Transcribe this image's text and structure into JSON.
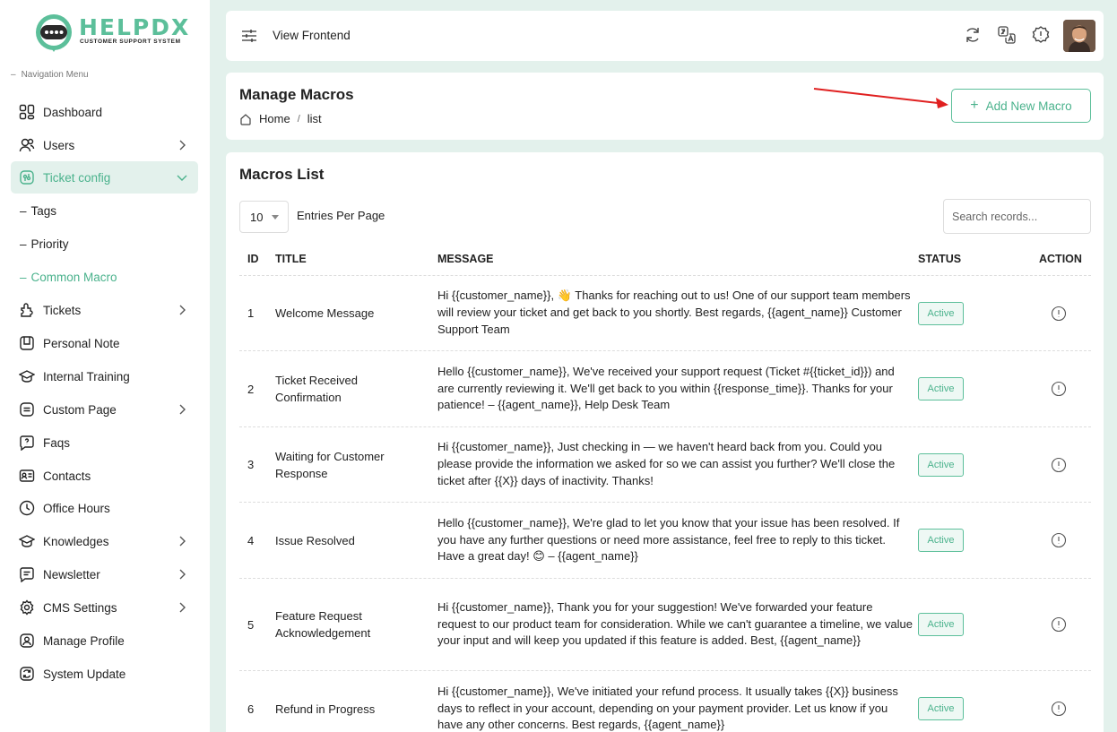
{
  "brand": {
    "name": "HELPDX",
    "tagline": "CUSTOMER SUPPORT SYSTEM",
    "color": "#5cbf9a"
  },
  "sidebar": {
    "section_title": "Navigation Menu",
    "items": [
      {
        "label": "Dashboard",
        "icon": "dashboard-icon"
      },
      {
        "label": "Users",
        "icon": "users-icon",
        "expandable": true
      },
      {
        "label": "Ticket config",
        "icon": "ticket-config-icon",
        "expandable": true,
        "expanded": true,
        "active": true
      },
      {
        "label": "Tags",
        "sub": true
      },
      {
        "label": "Priority",
        "sub": true
      },
      {
        "label": "Common Macro",
        "sub": true,
        "active": true
      },
      {
        "label": "Tickets",
        "icon": "tickets-icon",
        "expandable": true
      },
      {
        "label": "Personal Note",
        "icon": "note-icon"
      },
      {
        "label": "Internal Training",
        "icon": "training-icon"
      },
      {
        "label": "Custom Page",
        "icon": "custom-page-icon",
        "expandable": true
      },
      {
        "label": "Faqs",
        "icon": "faq-icon"
      },
      {
        "label": "Contacts",
        "icon": "contacts-icon"
      },
      {
        "label": "Office Hours",
        "icon": "clock-icon"
      },
      {
        "label": "Knowledges",
        "icon": "knowledge-icon",
        "expandable": true
      },
      {
        "label": "Newsletter",
        "icon": "newsletter-icon",
        "expandable": true
      },
      {
        "label": "CMS Settings",
        "icon": "settings-icon",
        "expandable": true
      },
      {
        "label": "Manage Profile",
        "icon": "profile-icon"
      },
      {
        "label": "System Update",
        "icon": "update-icon"
      }
    ]
  },
  "topbar": {
    "view_frontend": "View Frontend",
    "icons": [
      "refresh-icon",
      "translate-icon",
      "alert-icon"
    ]
  },
  "header": {
    "title": "Manage Macros",
    "breadcrumb": {
      "home": "Home",
      "current": "list"
    },
    "add_button": "Add New Macro"
  },
  "list": {
    "title": "Macros List",
    "entries_value": "10",
    "entries_label": "Entries Per Page",
    "search_placeholder": "Search records...",
    "columns": {
      "id": "ID",
      "title": "TITLE",
      "message": "MESSAGE",
      "status": "STATUS",
      "action": "ACTION"
    },
    "rows": [
      {
        "id": "1",
        "title": "Welcome Message",
        "message": "Hi {{customer_name}}, 👋 Thanks for reaching out to us! One of our support team members will review your ticket and get back to you shortly. Best regards, {{agent_name}} Customer Support Team",
        "status": "Active"
      },
      {
        "id": "2",
        "title": "Ticket Received Confirmation",
        "message": "Hello {{customer_name}}, We've received your support request (Ticket #{{ticket_id}}) and are currently reviewing it. We'll get back to you within {{response_time}}. Thanks for your patience! – {{agent_name}}, Help Desk Team",
        "status": "Active"
      },
      {
        "id": "3",
        "title": "Waiting for Customer Response",
        "message": "Hi {{customer_name}}, Just checking in — we haven't heard back from you. Could you please provide the information we asked for so we can assist you further? We'll close the ticket after {{X}} days of inactivity. Thanks!",
        "status": "Active"
      },
      {
        "id": "4",
        "title": "Issue Resolved",
        "message": "Hello {{customer_name}}, We're glad to let you know that your issue has been resolved. If you have any further questions or need more assistance, feel free to reply to this ticket. Have a great day! 😊 – {{agent_name}}",
        "status": "Active"
      },
      {
        "id": "5",
        "title": "Feature Request Acknowledgement",
        "message": "Hi {{customer_name}}, Thank you for your suggestion! We've forwarded your feature request to our product team for consideration. While we can't guarantee a timeline, we value your input and will keep you updated if this feature is added. Best, {{agent_name}}",
        "status": "Active"
      },
      {
        "id": "6",
        "title": "Refund in Progress",
        "message": "Hi {{customer_name}}, We've initiated your refund process. It usually takes {{X}} business days to reflect in your account, depending on your payment provider. Let us know if you have any other concerns. Best regards, {{agent_name}}",
        "status": "Active"
      }
    ]
  }
}
